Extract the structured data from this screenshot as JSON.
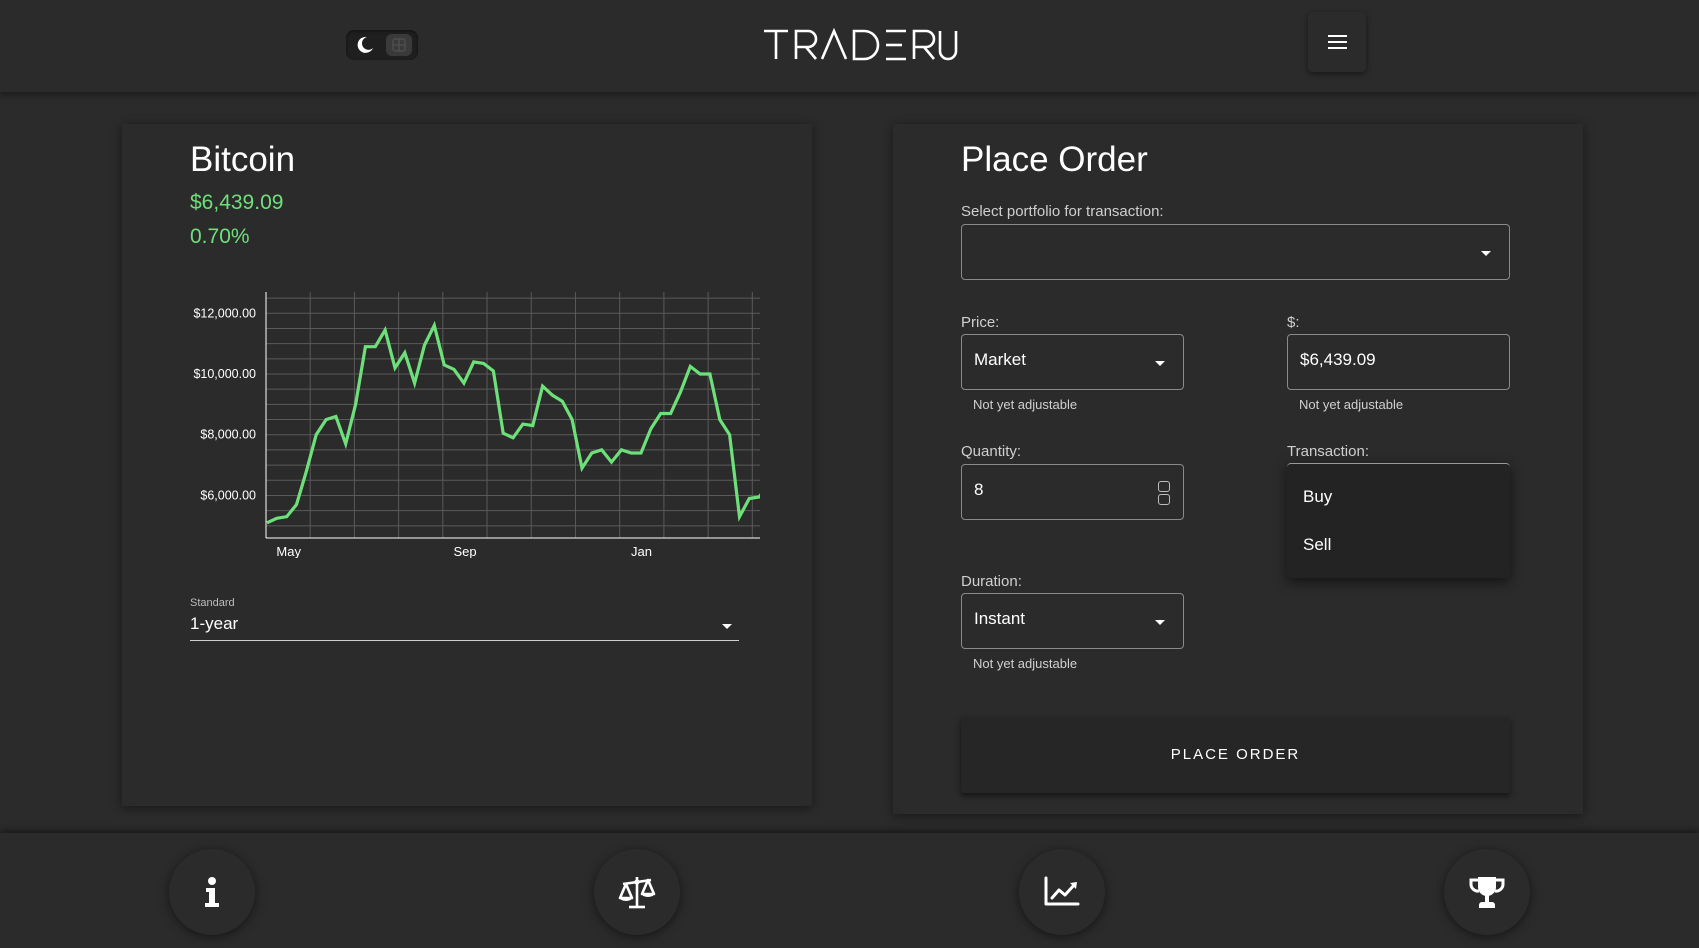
{
  "header": {
    "logo_text": "TRADERU",
    "theme_toggle_icon": "moon-icon",
    "menu_icon": "hamburger-icon"
  },
  "asset": {
    "name": "Bitcoin",
    "price": "$6,439.09",
    "change": "0.70%",
    "accent_color": "#6ee07a"
  },
  "chart_data": {
    "type": "line",
    "title": "",
    "xlabel": "",
    "ylabel": "",
    "x_tick_labels": [
      "May",
      "Sep",
      "Jan"
    ],
    "y_tick_labels": [
      "$12,000.00",
      "$10,000.00",
      "$8,000.00",
      "$6,000.00"
    ],
    "y_ticks": [
      12000,
      10000,
      8000,
      6000
    ],
    "ylim": [
      4600,
      12700
    ],
    "grid": true,
    "series": [
      {
        "color": "#6ee07a",
        "values": [
          5100,
          5250,
          5300,
          5700,
          6800,
          8000,
          8500,
          8600,
          7700,
          9000,
          10900,
          10900,
          11450,
          10200,
          10700,
          9700,
          10950,
          11600,
          10300,
          10150,
          9700,
          10400,
          10350,
          10100,
          8050,
          7900,
          8350,
          8300,
          9600,
          9300,
          9100,
          8500,
          6900,
          7400,
          7500,
          7100,
          7500,
          7400,
          7400,
          8200,
          8700,
          8700,
          9400,
          10250,
          10000,
          10000,
          8500,
          8000,
          5300,
          5900,
          5950,
          6400
        ]
      }
    ]
  },
  "period": {
    "label": "Standard",
    "value": "1-year"
  },
  "order": {
    "title": "Place Order",
    "portfolio_label": "Select portfolio for transaction:",
    "portfolio_value": "",
    "price_label": "Price:",
    "price_value": "Market",
    "price_helper": "Not yet adjustable",
    "amount_label": "$:",
    "amount_value": "$6,439.09",
    "amount_helper": "Not yet adjustable",
    "quantity_label": "Quantity:",
    "quantity_value": "8",
    "transaction_label": "Transaction:",
    "transaction_options": [
      "Buy",
      "Sell"
    ],
    "duration_label": "Duration:",
    "duration_value": "Instant",
    "duration_helper": "Not yet adjustable",
    "submit_label": "PLACE ORDER"
  },
  "bottom_nav": {
    "icons": [
      "info-icon",
      "scales-icon",
      "chart-line-icon",
      "trophy-icon"
    ]
  }
}
